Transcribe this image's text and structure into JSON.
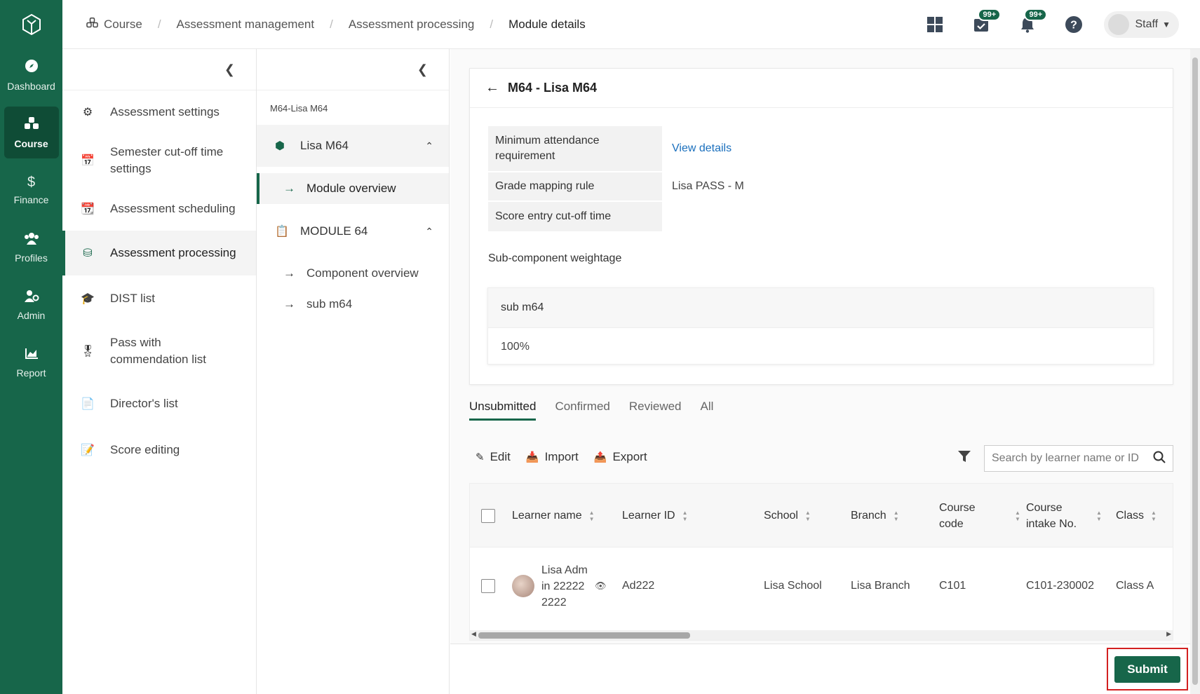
{
  "rail": {
    "items": [
      {
        "label": "Dashboard",
        "icon": "compass-icon"
      },
      {
        "label": "Course",
        "icon": "cubes-icon",
        "active": true
      },
      {
        "label": "Finance",
        "icon": "dollar-icon"
      },
      {
        "label": "Profiles",
        "icon": "users-icon"
      },
      {
        "label": "Admin",
        "icon": "user-gear-icon"
      },
      {
        "label": "Report",
        "icon": "chart-icon"
      }
    ]
  },
  "breadcrumb": [
    "Course",
    "Assessment management",
    "Assessment processing",
    "Module details"
  ],
  "header": {
    "tasks_badge": "99+",
    "notifications_badge": "99+",
    "user_label": "Staff"
  },
  "panel1": {
    "items": [
      {
        "label": "Assessment settings"
      },
      {
        "label": "Semester cut-off time settings"
      },
      {
        "label": "Assessment scheduling"
      },
      {
        "label": "Assessment processing",
        "active": true
      },
      {
        "label": "DIST list"
      },
      {
        "label": "Pass with commendation list"
      },
      {
        "label": "Director's list"
      },
      {
        "label": "Score editing"
      }
    ]
  },
  "panel2": {
    "title": "M64-Lisa M64",
    "group1": "Lisa M64",
    "group1_items": [
      "Module overview"
    ],
    "group2": "MODULE 64",
    "group2_items": [
      "Component overview",
      "sub m64"
    ]
  },
  "card": {
    "title": "M64 - Lisa M64",
    "fields": [
      {
        "label": "Minimum attendance requirement",
        "value": "View details"
      },
      {
        "label": "Grade mapping rule",
        "value": "Lisa PASS - M"
      },
      {
        "label": "Score entry cut-off time",
        "value": ""
      }
    ],
    "subweight_label": "Sub-component weightage",
    "subweight_name": "sub m64",
    "subweight_value": "100%"
  },
  "tabs": [
    "Unsubmitted",
    "Confirmed",
    "Reviewed",
    "All"
  ],
  "toolbar": {
    "edit": "Edit",
    "import": "Import",
    "export": "Export",
    "search_placeholder": "Search by learner name or ID"
  },
  "table": {
    "columns": [
      "Learner name",
      "Learner ID",
      "School",
      "Branch",
      "Course code",
      "Course intake No.",
      "Class"
    ],
    "rows": [
      {
        "name": "Lisa Admin 222222222",
        "id": "Ad222",
        "school": "Lisa School",
        "branch": "Lisa Branch",
        "course_code": "C101",
        "intake": "C101-230002",
        "class": "Class A"
      }
    ]
  },
  "footer": {
    "submit": "Submit"
  },
  "colors": {
    "brand": "#17664a",
    "link": "#1a6fbd",
    "highlight": "#d32020"
  }
}
